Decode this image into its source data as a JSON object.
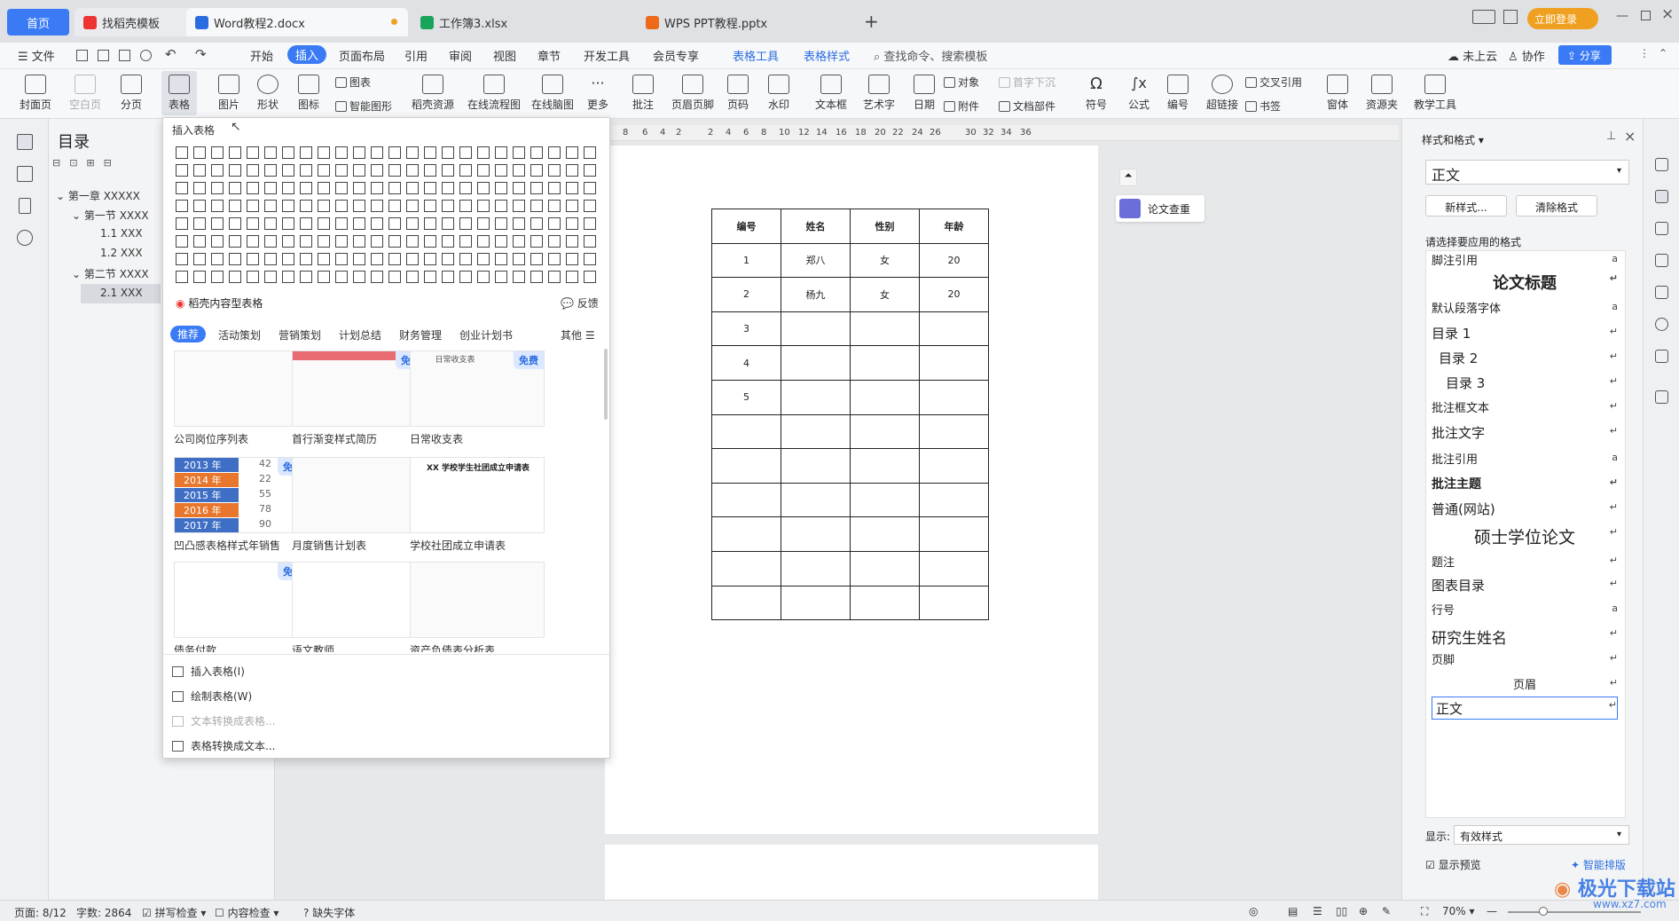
{
  "tabs": {
    "home": "首页",
    "tab1": "找稻壳模板",
    "tab2": "Word教程2.docx",
    "tab3": "工作簿3.xlsx",
    "tab4": "WPS PPT教程.pptx",
    "login": "立即登录"
  },
  "menu": {
    "file": "文件",
    "items": [
      "开始",
      "插入",
      "页面布局",
      "引用",
      "审阅",
      "视图",
      "章节",
      "开发工具",
      "会员专享",
      "表格工具",
      "表格样式"
    ],
    "search": "查找命令、搜索模板",
    "cloud": "未上云",
    "collab": "协作",
    "share": "分享"
  },
  "ribbon": {
    "cover": "封面页",
    "blank": "空白页",
    "pagebreak": "分页",
    "table": "表格",
    "picture": "图片",
    "shape": "形状",
    "icon": "图标",
    "chart": "图表",
    "smartart": "智能图形",
    "daoke": "稻壳资源",
    "flow": "在线流程图",
    "mind": "在线脑图",
    "more": "更多",
    "comment": "批注",
    "header": "页眉页脚",
    "pagenum": "页码",
    "watermark": "水印",
    "textbox": "文本框",
    "wordart": "艺术字",
    "date": "日期",
    "object": "对象",
    "attach": "附件",
    "dropcap": "首字下沉",
    "docpart": "文档部件",
    "symbol": "符号",
    "formula": "公式",
    "number": "编号",
    "hyperlink": "超链接",
    "crossref": "交叉引用",
    "bookmark": "书签",
    "window": "窗体",
    "resource": "资源夹",
    "teach": "教学工具"
  },
  "toc": {
    "title": "目录",
    "items": [
      "第一章 XXXXX",
      "第一节 XXXX",
      "1.1 XXX",
      "1.2 XXX",
      "第二节 XXXX",
      "2.1 XXX"
    ]
  },
  "ruler": [
    "8",
    "6",
    "4",
    "2",
    "2",
    "4",
    "6",
    "8",
    "10",
    "12",
    "14",
    "16",
    "18",
    "20",
    "22",
    "24",
    "26",
    "30",
    "32",
    "34",
    "36"
  ],
  "popup": {
    "header": "插入表格",
    "daoke": "稻壳内容型表格",
    "feedback": "反馈",
    "cats": [
      "推荐",
      "活动策划",
      "营销策划",
      "计划总结",
      "财务管理",
      "创业计划书"
    ],
    "other": "其他",
    "templates": [
      "公司岗位序列表",
      "首行渐变样式简历",
      "日常收支表",
      "凹凸感表格样式年销售",
      "月度销售计划表",
      "学校社团成立申请表",
      "债务付款",
      "语文教师",
      "资产负债表分析表"
    ],
    "free": "免费",
    "yearrows": [
      [
        "2013 年",
        "42"
      ],
      [
        "2014 年",
        "22"
      ],
      [
        "2015 年",
        "55"
      ],
      [
        "2016 年",
        "78"
      ],
      [
        "2017 年",
        "90"
      ]
    ],
    "yearcolors": [
      "#3f6fc5",
      "#e8762c",
      "#3f6fc5",
      "#e8762c",
      "#3f6fc5"
    ],
    "cardtitle": "XX 学校学生社团成立申请表",
    "dailytitle": "日常收支表",
    "actions": [
      "插入表格(I)",
      "绘制表格(W)",
      "文本转换成表格...",
      "表格转换成文本..."
    ]
  },
  "table": {
    "headers": [
      "编号",
      "姓名",
      "性别",
      "年龄"
    ],
    "rows": [
      [
        "1",
        "郑八",
        "女",
        "20"
      ],
      [
        "2",
        "杨九",
        "女",
        "20"
      ],
      [
        "3",
        "",
        "",
        ""
      ],
      [
        "4",
        "",
        "",
        ""
      ],
      [
        "5",
        "",
        "",
        ""
      ],
      [
        "",
        "",
        "",
        ""
      ],
      [
        "",
        "",
        "",
        ""
      ],
      [
        "",
        "",
        "",
        ""
      ],
      [
        "",
        "",
        "",
        ""
      ],
      [
        "",
        "",
        "",
        ""
      ],
      [
        "",
        "",
        "",
        ""
      ]
    ]
  },
  "paper_check": "论文查重",
  "styles": {
    "title": "样式和格式",
    "current": "正文",
    "new": "新样式...",
    "clear": "清除格式",
    "prompt": "请选择要应用的格式",
    "list": [
      "脚注引用",
      "论文标题",
      "默认段落字体",
      "目录 1",
      "目录 2",
      "目录 3",
      "批注框文本",
      "批注文字",
      "批注引用",
      "批注主题",
      "普通(网站)",
      "硕士学位论文",
      "题注",
      "图表目录",
      "行号",
      "研究生姓名",
      "页脚",
      "页眉",
      "正文"
    ],
    "marks": [
      "a",
      "↵",
      "a",
      "↵",
      "↵",
      "↵",
      "↵",
      "↵",
      "a",
      "↵",
      "↵",
      "↵",
      "↵",
      "↵",
      "a",
      "↵",
      "↵",
      "↵",
      "↵"
    ],
    "show_label": "显示:",
    "show_value": "有效样式",
    "preview": "显示预览",
    "smart": "智能排版"
  },
  "status": {
    "page": "页面: 8/12",
    "words": "字数: 2864",
    "spell": "拼写检查",
    "content": "内容检查",
    "font": "缺失字体",
    "zoom": "70%"
  },
  "watermark": "极光下载站",
  "watermark_url": "www.xz7.com"
}
